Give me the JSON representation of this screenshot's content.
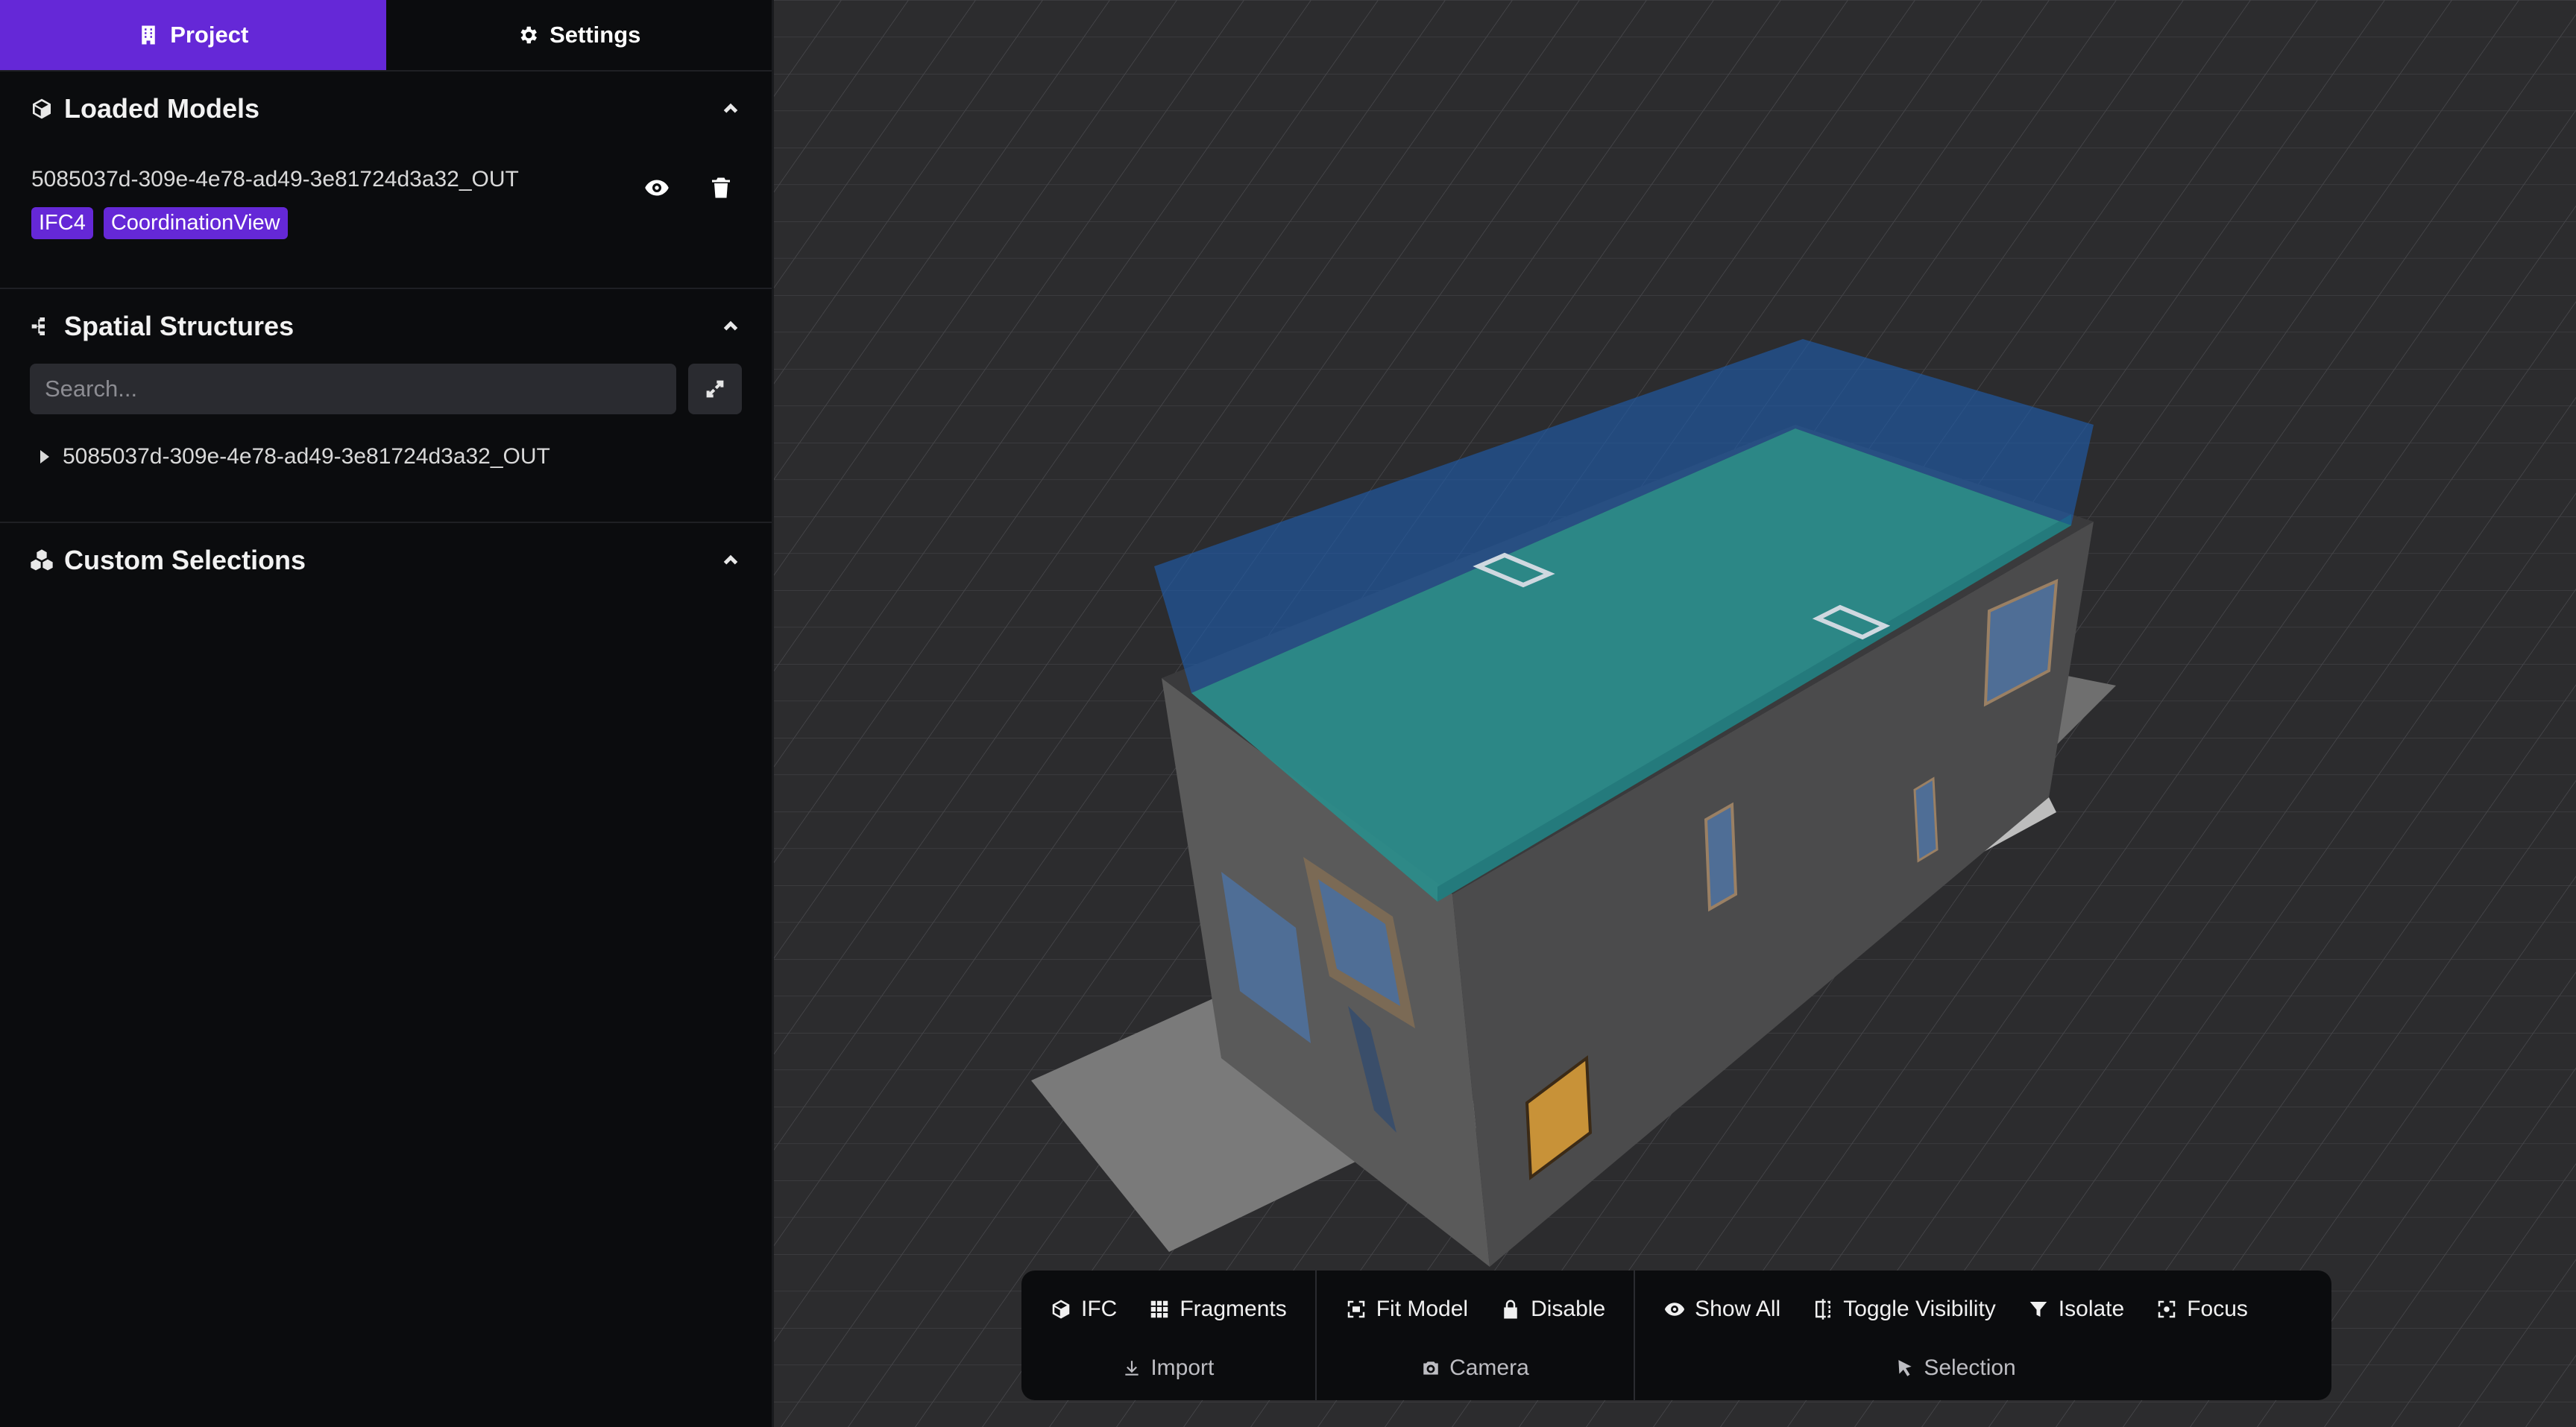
{
  "tabs": [
    {
      "label": "Project",
      "icon": "building-icon",
      "active": true
    },
    {
      "label": "Settings",
      "icon": "gear-icon",
      "active": false
    }
  ],
  "loaded_models": {
    "title": "Loaded Models",
    "model_name": "5085037d-309e-4e78-ad49-3e81724d3a32_OUT",
    "badges": [
      "IFC4",
      "CoordinationView"
    ]
  },
  "spatial_structures": {
    "title": "Spatial Structures",
    "search_placeholder": "Search...",
    "tree_item": "5085037d-309e-4e78-ad49-3e81724d3a32_OUT"
  },
  "custom_selections": {
    "title": "Custom Selections"
  },
  "toolbar": {
    "import": {
      "label": "Import",
      "buttons": [
        "IFC",
        "Fragments"
      ]
    },
    "camera": {
      "label": "Camera",
      "buttons": [
        "Fit Model",
        "Disable"
      ]
    },
    "selection": {
      "label": "Selection",
      "buttons": [
        "Show All",
        "Toggle Visibility",
        "Isolate",
        "Focus"
      ]
    }
  },
  "colors": {
    "accent": "#6528d7",
    "sidebar_bg": "#0b0c0e",
    "viewport_bg": "#2c2c2e"
  }
}
